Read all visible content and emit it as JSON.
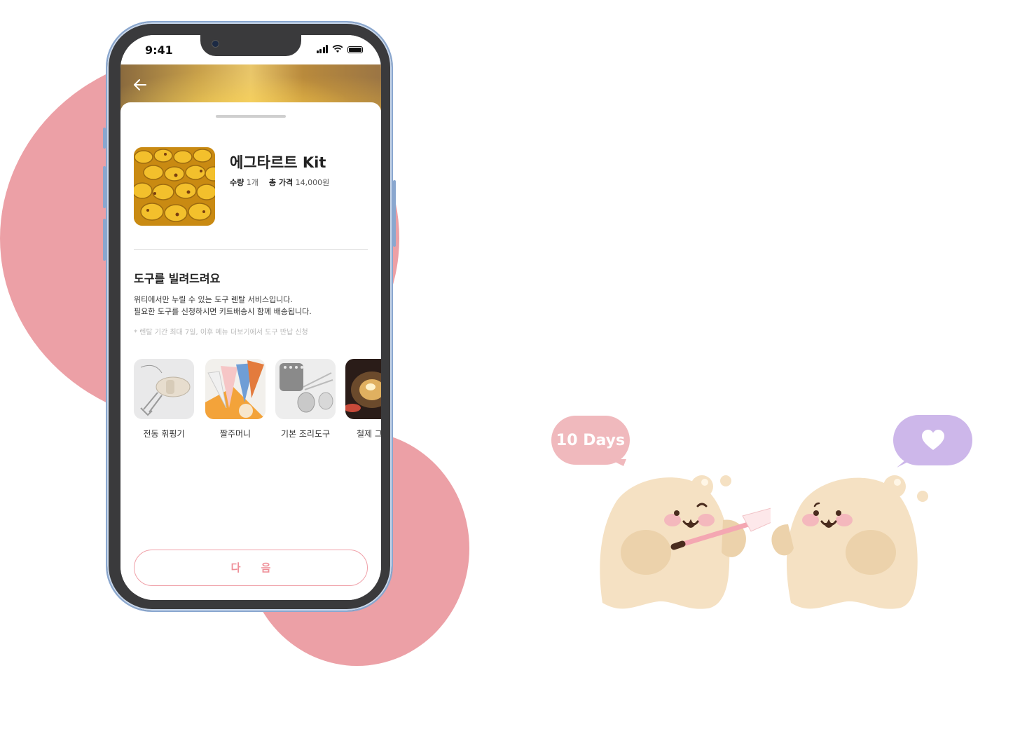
{
  "statusbar": {
    "time": "9:41"
  },
  "product": {
    "name": "에그타르트 Kit",
    "quantity_label": "수량",
    "quantity_value": "1개",
    "total_label": "총 가격",
    "total_value": "14,000원"
  },
  "rental": {
    "title": "도구를 빌려드려요",
    "desc_line1": "위티에서만 누릴 수 있는 도구 렌탈 서비스입니다.",
    "desc_line2": "필요한 도구를 신청하시면 키트배송시 함께 배송됩니다.",
    "note": "* 렌탈 기간 최대 7일, 이후 메뉴 더보기에서 도구 반납 신청"
  },
  "tools": [
    {
      "label": "전동 휘핑기"
    },
    {
      "label": "짤주머니"
    },
    {
      "label": "기본 조리도구"
    },
    {
      "label": "철제 그"
    }
  ],
  "next_button": {
    "label": "다 음"
  },
  "illustration": {
    "bubble_left_text": "10 Days",
    "bubble_right_icon": "heart-icon"
  },
  "colors": {
    "blob": "#eca0a6",
    "accent": "#ef8f98",
    "mascot": "#f5e1c3"
  }
}
